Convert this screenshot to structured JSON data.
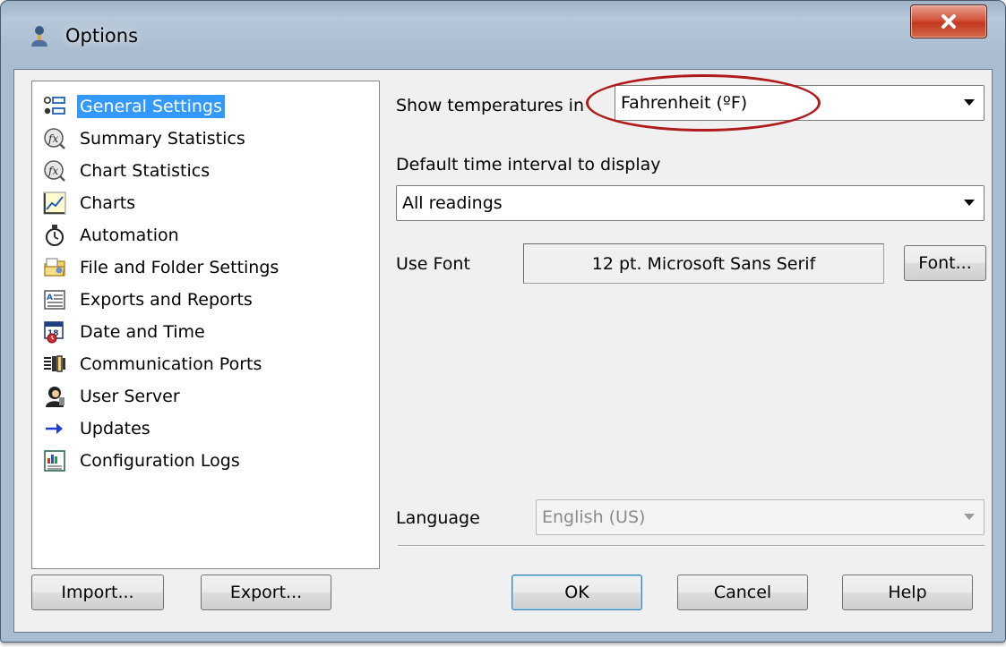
{
  "window": {
    "title": "Options",
    "app_icon": "user-icon",
    "close_icon": "close-icon"
  },
  "colors": {
    "selection": "#3399ff",
    "annotation": "#b01c1c",
    "close_button": "#c2381f"
  },
  "nav": {
    "items": [
      {
        "label": "General Settings",
        "icon": "list-settings-icon",
        "selected": true
      },
      {
        "label": "Summary Statistics",
        "icon": "function-statistics-icon"
      },
      {
        "label": "Chart Statistics",
        "icon": "function-statistics-icon"
      },
      {
        "label": "Charts",
        "icon": "line-chart-icon"
      },
      {
        "label": "Automation",
        "icon": "stopwatch-icon"
      },
      {
        "label": "File and Folder Settings",
        "icon": "folder-settings-icon"
      },
      {
        "label": "Exports and Reports",
        "icon": "report-icon"
      },
      {
        "label": "Date and Time",
        "icon": "calendar-clock-icon"
      },
      {
        "label": "Communication Ports",
        "icon": "ports-icon"
      },
      {
        "label": "User Server",
        "icon": "user-server-icon"
      },
      {
        "label": "Updates",
        "icon": "arrow-right-icon"
      },
      {
        "label": "Configuration Logs",
        "icon": "log-chart-icon"
      }
    ]
  },
  "general": {
    "temp_label": "Show temperatures in",
    "temp_value": "Fahrenheit (ºF)",
    "interval_label": "Default time interval to display",
    "interval_value": "All readings",
    "font_label": "Use Font",
    "font_value": "12 pt. Microsoft Sans Serif",
    "font_button": "Font...",
    "language_label": "Language",
    "language_value": "English (US)"
  },
  "buttons": {
    "import": "Import...",
    "export": "Export...",
    "ok": "OK",
    "cancel": "Cancel",
    "help": "Help"
  }
}
